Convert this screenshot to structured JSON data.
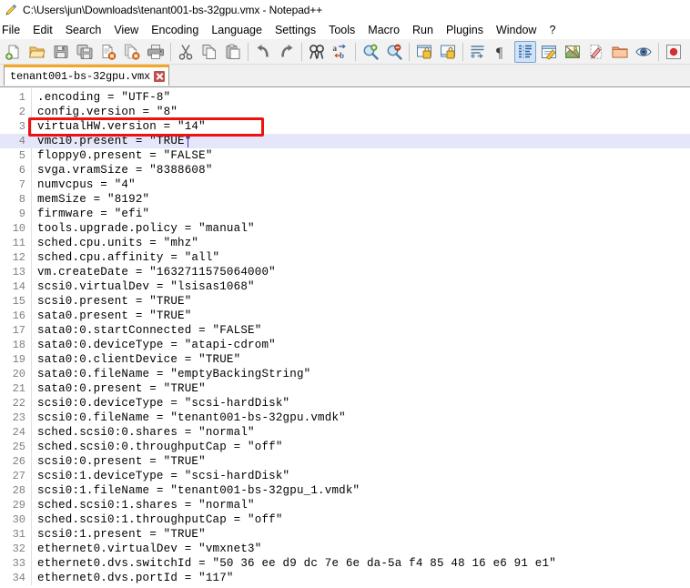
{
  "window": {
    "title": "C:\\Users\\jun\\Downloads\\tenant001-bs-32gpu.vmx - Notepad++",
    "app_icon": "notepad-plus-plus-icon"
  },
  "menu": {
    "items": [
      {
        "label": "File"
      },
      {
        "label": "Edit"
      },
      {
        "label": "Search"
      },
      {
        "label": "View"
      },
      {
        "label": "Encoding"
      },
      {
        "label": "Language"
      },
      {
        "label": "Settings"
      },
      {
        "label": "Tools"
      },
      {
        "label": "Macro"
      },
      {
        "label": "Run"
      },
      {
        "label": "Plugins"
      },
      {
        "label": "Window"
      },
      {
        "label": "?"
      }
    ]
  },
  "toolbar": {
    "buttons": [
      {
        "name": "new-file-icon",
        "title": "New"
      },
      {
        "name": "open-file-icon",
        "title": "Open"
      },
      {
        "name": "save-icon",
        "title": "Save"
      },
      {
        "name": "save-all-icon",
        "title": "Save All"
      },
      {
        "name": "close-file-icon",
        "title": "Close"
      },
      {
        "name": "close-all-icon",
        "title": "Close All"
      },
      {
        "name": "print-icon",
        "title": "Print"
      },
      {
        "name": "separator",
        "title": ""
      },
      {
        "name": "cut-icon",
        "title": "Cut"
      },
      {
        "name": "copy-icon",
        "title": "Copy"
      },
      {
        "name": "paste-icon",
        "title": "Paste"
      },
      {
        "name": "separator",
        "title": ""
      },
      {
        "name": "undo-icon",
        "title": "Undo"
      },
      {
        "name": "redo-icon",
        "title": "Redo"
      },
      {
        "name": "separator",
        "title": ""
      },
      {
        "name": "find-icon",
        "title": "Find"
      },
      {
        "name": "replace-icon",
        "title": "Replace"
      },
      {
        "name": "separator",
        "title": ""
      },
      {
        "name": "zoom-in-icon",
        "title": "Zoom In"
      },
      {
        "name": "zoom-out-icon",
        "title": "Zoom Out"
      },
      {
        "name": "separator",
        "title": ""
      },
      {
        "name": "sync-vertical-icon",
        "title": "Synchronize Vertical Scrolling"
      },
      {
        "name": "sync-horizontal-icon",
        "title": "Synchronize Horizontal Scrolling"
      },
      {
        "name": "separator",
        "title": ""
      },
      {
        "name": "word-wrap-icon",
        "title": "Word Wrap"
      },
      {
        "name": "show-all-chars-icon",
        "title": "Show All Characters"
      },
      {
        "name": "indent-guide-icon",
        "title": "Show Indent Guide"
      },
      {
        "name": "user-lang-icon",
        "title": "User Defined Dialogue"
      },
      {
        "name": "document-map-icon",
        "title": "Document Map"
      },
      {
        "name": "function-list-icon",
        "title": "Function List"
      },
      {
        "name": "folder-workspace-icon",
        "title": "Folder as Workspace"
      },
      {
        "name": "monitoring-icon",
        "title": "Monitoring"
      },
      {
        "name": "separator",
        "title": ""
      },
      {
        "name": "record-macro-icon",
        "title": "Start Recording"
      },
      {
        "name": "stop-macro-icon",
        "title": "Stop Recording"
      },
      {
        "name": "play-macro-icon",
        "title": "Playback"
      },
      {
        "name": "run-multi-macro-icon",
        "title": "Run a Macro Multiple Times"
      },
      {
        "name": "save-macro-icon",
        "title": "Save Currently Recorded Macro"
      }
    ]
  },
  "tabs": [
    {
      "label": "tenant001-bs-32gpu.vmx",
      "active": true,
      "close_icon": "close-tab-icon"
    }
  ],
  "editor": {
    "current_line": 4,
    "caret_line": 4,
    "caret_col": 21,
    "annotation": {
      "type": "rectangle",
      "color": "#ee1111",
      "target_line": 3
    },
    "lines": [
      {
        "n": "1",
        "text": ".encoding = \"UTF-8\""
      },
      {
        "n": "2",
        "text": "config.version = \"8\""
      },
      {
        "n": "3",
        "text": "virtualHW.version = \"14\""
      },
      {
        "n": "4",
        "text": "vmci0.present = \"TRUE\""
      },
      {
        "n": "5",
        "text": "floppy0.present = \"FALSE\""
      },
      {
        "n": "6",
        "text": "svga.vramSize = \"8388608\""
      },
      {
        "n": "7",
        "text": "numvcpus = \"4\""
      },
      {
        "n": "8",
        "text": "memSize = \"8192\""
      },
      {
        "n": "9",
        "text": "firmware = \"efi\""
      },
      {
        "n": "10",
        "text": "tools.upgrade.policy = \"manual\""
      },
      {
        "n": "11",
        "text": "sched.cpu.units = \"mhz\""
      },
      {
        "n": "12",
        "text": "sched.cpu.affinity = \"all\""
      },
      {
        "n": "13",
        "text": "vm.createDate = \"1632711575064000\""
      },
      {
        "n": "14",
        "text": "scsi0.virtualDev = \"lsisas1068\""
      },
      {
        "n": "15",
        "text": "scsi0.present = \"TRUE\""
      },
      {
        "n": "16",
        "text": "sata0.present = \"TRUE\""
      },
      {
        "n": "17",
        "text": "sata0:0.startConnected = \"FALSE\""
      },
      {
        "n": "18",
        "text": "sata0:0.deviceType = \"atapi-cdrom\""
      },
      {
        "n": "19",
        "text": "sata0:0.clientDevice = \"TRUE\""
      },
      {
        "n": "20",
        "text": "sata0:0.fileName = \"emptyBackingString\""
      },
      {
        "n": "21",
        "text": "sata0:0.present = \"TRUE\""
      },
      {
        "n": "22",
        "text": "scsi0:0.deviceType = \"scsi-hardDisk\""
      },
      {
        "n": "23",
        "text": "scsi0:0.fileName = \"tenant001-bs-32gpu.vmdk\""
      },
      {
        "n": "24",
        "text": "sched.scsi0:0.shares = \"normal\""
      },
      {
        "n": "25",
        "text": "sched.scsi0:0.throughputCap = \"off\""
      },
      {
        "n": "26",
        "text": "scsi0:0.present = \"TRUE\""
      },
      {
        "n": "27",
        "text": "scsi0:1.deviceType = \"scsi-hardDisk\""
      },
      {
        "n": "28",
        "text": "scsi0:1.fileName = \"tenant001-bs-32gpu_1.vmdk\""
      },
      {
        "n": "29",
        "text": "sched.scsi0:1.shares = \"normal\""
      },
      {
        "n": "30",
        "text": "sched.scsi0:1.throughputCap = \"off\""
      },
      {
        "n": "31",
        "text": "scsi0:1.present = \"TRUE\""
      },
      {
        "n": "32",
        "text": "ethernet0.virtualDev = \"vmxnet3\""
      },
      {
        "n": "33",
        "text": "ethernet0.dvs.switchId = \"50 36 ee d9 dc 7e 6e da-5a f4 85 48 16 e6 91 e1\""
      },
      {
        "n": "34",
        "text": "ethernet0.dvs.portId = \"117\""
      }
    ]
  },
  "colors": {
    "accent_orange": "#f6a623",
    "annotation_red": "#ee1111",
    "current_line_bg": "#e6e6fa",
    "toolbar_bg": "#f2f2f2",
    "gutter_fg": "#808080"
  }
}
